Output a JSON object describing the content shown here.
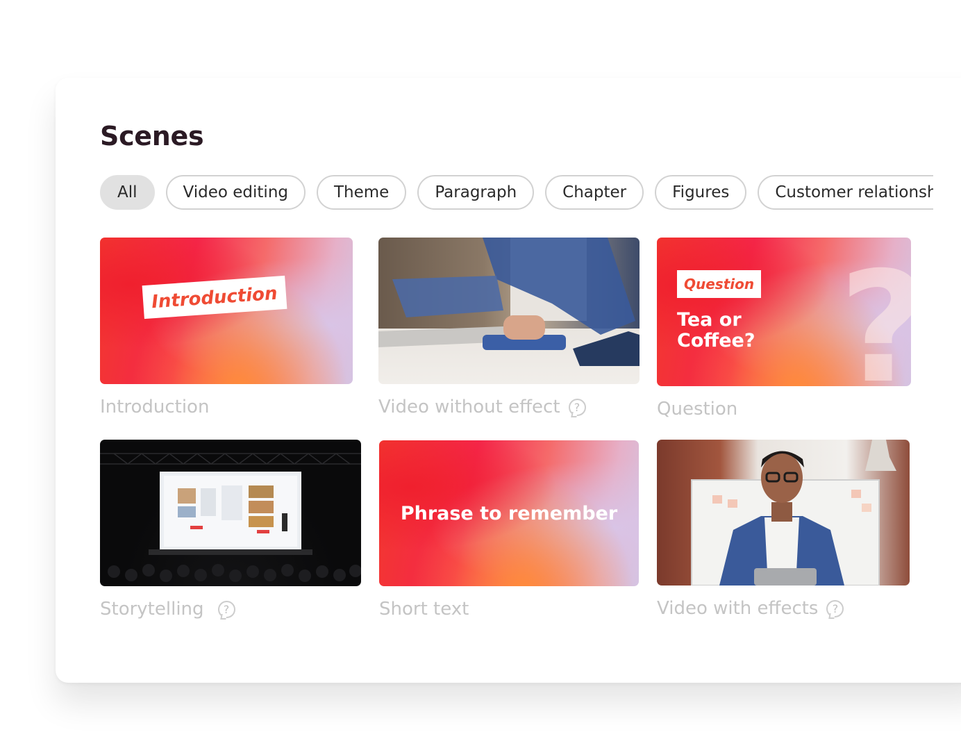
{
  "title": "Scenes",
  "filters": [
    {
      "label": "All",
      "active": true
    },
    {
      "label": "Video editing",
      "active": false
    },
    {
      "label": "Theme",
      "active": false
    },
    {
      "label": "Paragraph",
      "active": false
    },
    {
      "label": "Chapter",
      "active": false
    },
    {
      "label": "Figures",
      "active": false
    },
    {
      "label": "Customer relationship",
      "active": false
    }
  ],
  "scenes": [
    {
      "label": "Introduction",
      "thumb_text": "Introduction",
      "help": false
    },
    {
      "label": "Video without effect",
      "help": true,
      "help_icon": "?"
    },
    {
      "label": "Question",
      "thumb_tag": "Question",
      "thumb_text": "Tea or Coffee?",
      "help": false
    },
    {
      "label": "Storytelling",
      "help": true,
      "help_icon": "?"
    },
    {
      "label": "Short text",
      "thumb_text": "Phrase to remember",
      "help": false
    },
    {
      "label": "Video with effects",
      "help": true,
      "help_icon": "?"
    }
  ],
  "colors": {
    "accent": "#ef4b34",
    "title": "#2b1a24",
    "label": "#c4c4c4",
    "chip_active_bg": "#e1e1e1",
    "chip_border": "#d2d2d2"
  }
}
